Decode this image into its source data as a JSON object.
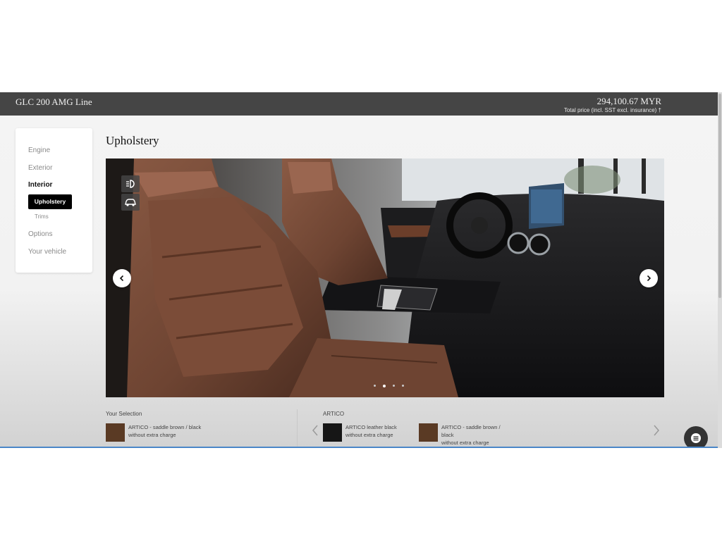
{
  "header": {
    "model": "GLC 200 AMG Line",
    "price": "294,100.67 MYR",
    "price_note": "Total price (incl. SST excl. insurance) †"
  },
  "sidebar": {
    "items": [
      {
        "label": "Engine"
      },
      {
        "label": "Exterior"
      },
      {
        "label": "Interior"
      },
      {
        "label": "Upholstery"
      },
      {
        "label": "Trims"
      },
      {
        "label": "Options"
      },
      {
        "label": "Your vehicle"
      }
    ],
    "active_item": "Upholstery"
  },
  "main": {
    "title": "Upholstery",
    "gallery": {
      "view_icons": [
        "headlight-icon",
        "car-exterior-icon"
      ],
      "slides": 4,
      "current_slide": 2
    }
  },
  "selection": {
    "label": "Your Selection",
    "name": "ARTICO - saddle brown / black",
    "price": "without extra charge",
    "color": "#5a3a24"
  },
  "artico": {
    "label": "ARTICO",
    "options": [
      {
        "name": "ARTICO leather black",
        "price": "without extra charge",
        "color": "#161616"
      },
      {
        "name_line1": "ARTICO - saddle brown /",
        "name_line2": "black",
        "price": "without extra charge",
        "color": "#5a3a24"
      }
    ]
  },
  "colors": {
    "topbar": "#454545",
    "accent": "#000000"
  }
}
